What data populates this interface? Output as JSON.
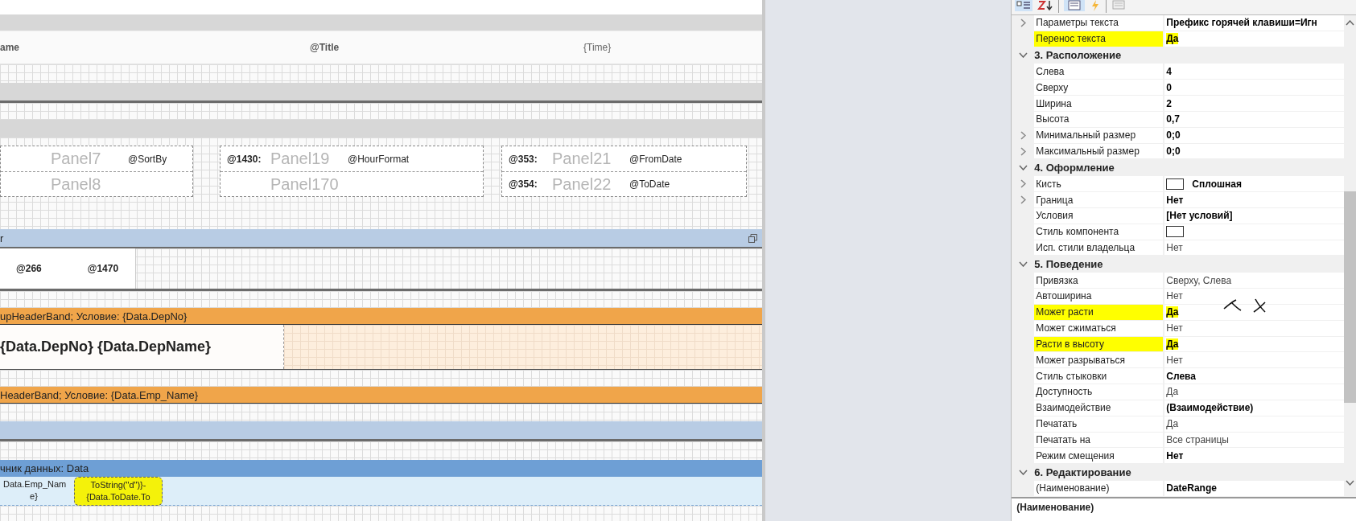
{
  "designer": {
    "page_header": {
      "cells": [
        "ame",
        "@Title",
        "{Time}"
      ]
    },
    "panels": [
      {
        "cells": [
          {
            "value": "@SortBy",
            "ghost": "Panel7"
          },
          {
            "ghost": "Panel8"
          }
        ]
      },
      {
        "cells": [
          {
            "label": "@1430:",
            "value": "@HourFormat",
            "ghost": "Panel19"
          },
          {
            "ghost": "Panel170"
          }
        ]
      },
      {
        "cells": [
          {
            "label": "@353:",
            "value": "@FromDate",
            "ghost": "Panel21"
          },
          {
            "label": "@354:",
            "value": "@ToDate",
            "ghost": "Panel22"
          }
        ]
      }
    ],
    "header_band": {
      "title": "r",
      "cells": [
        "@266",
        "@1470"
      ]
    },
    "group_headers": [
      {
        "title": "upHeaderBand; Условие: {Data.DepNo}",
        "content": "{Data.DepNo} {Data.DepName}"
      },
      {
        "title": "HeaderBand; Условие: {Data.Emp_Name}"
      }
    ],
    "data_band": {
      "title": "чник данных: Data",
      "cells": [
        {
          "text": "Data.Emp_Nam\ne}",
          "selected": false
        },
        {
          "text": "ToString(\"d\")}-\n{Data.ToDate.To",
          "selected": true
        }
      ]
    }
  },
  "property_grid": {
    "rows": [
      {
        "name": "Параметры текста",
        "value": "Префикс горячей клавиши=Игн",
        "bold": true,
        "expandable": true,
        "highlighted": false,
        "swatch": false
      },
      {
        "name": "Перенос текста",
        "value": "Да",
        "bold": true,
        "expandable": false,
        "highlighted": true,
        "swatch": false
      }
    ],
    "categories": [
      {
        "title": "3. Расположение",
        "expanded": true,
        "rows": [
          {
            "name": "Слева",
            "value": "4",
            "bold": true,
            "expandable": false,
            "highlighted": false,
            "swatch": false
          },
          {
            "name": "Сверху",
            "value": "0",
            "bold": true,
            "expandable": false,
            "highlighted": false,
            "swatch": false
          },
          {
            "name": "Ширина",
            "value": "2",
            "bold": true,
            "expandable": false,
            "highlighted": false,
            "swatch": false
          },
          {
            "name": "Высота",
            "value": "0,7",
            "bold": true,
            "expandable": false,
            "highlighted": false,
            "swatch": false
          },
          {
            "name": "Минимальный размер",
            "value": "0;0",
            "bold": true,
            "expandable": true,
            "highlighted": false,
            "swatch": false
          },
          {
            "name": "Максимальный размер",
            "value": "0;0",
            "bold": true,
            "expandable": true,
            "highlighted": false,
            "swatch": false
          }
        ]
      },
      {
        "title": "4. Оформление",
        "expanded": true,
        "rows": [
          {
            "name": "Кисть",
            "value": "Сплошная",
            "bold": true,
            "expandable": true,
            "highlighted": false,
            "swatch": true
          },
          {
            "name": "Граница",
            "value": "Нет",
            "bold": true,
            "expandable": true,
            "highlighted": false,
            "swatch": false
          },
          {
            "name": "Условия",
            "value": "[Нет условий]",
            "bold": true,
            "expandable": false,
            "highlighted": false,
            "swatch": false
          },
          {
            "name": "Стиль компонента",
            "bold": false,
            "expandable": false,
            "highlighted": false,
            "swatch": true
          },
          {
            "name": "Исп. стили владельца",
            "value": "Нет",
            "bold": false,
            "expandable": false,
            "highlighted": false,
            "swatch": false
          }
        ]
      },
      {
        "title": "5. Поведение",
        "expanded": true,
        "rows": [
          {
            "name": "Привязка",
            "value": "Сверху, Слева",
            "bold": false,
            "expandable": false,
            "highlighted": false,
            "swatch": false
          },
          {
            "name": "Автоширина",
            "value": "Нет",
            "bold": false,
            "expandable": false,
            "highlighted": false,
            "swatch": false
          },
          {
            "name": "Может расти",
            "value": "Да",
            "bold": true,
            "expandable": false,
            "highlighted": true,
            "swatch": false
          },
          {
            "name": "Может сжиматься",
            "value": "Нет",
            "bold": false,
            "expandable": false,
            "highlighted": false,
            "swatch": false
          },
          {
            "name": "Расти в высоту",
            "value": "Да",
            "bold": true,
            "expandable": false,
            "highlighted": true,
            "swatch": false
          },
          {
            "name": "Может разрываться",
            "value": "Нет",
            "bold": false,
            "expandable": false,
            "highlighted": false,
            "swatch": false
          },
          {
            "name": "Стиль стыковки",
            "value": "Слева",
            "bold": true,
            "expandable": false,
            "highlighted": false,
            "swatch": false
          },
          {
            "name": "Доступность",
            "value": "Да",
            "bold": false,
            "expandable": false,
            "highlighted": false,
            "swatch": false
          },
          {
            "name": "Взаимодействие",
            "value": "(Взаимодействие)",
            "bold": true,
            "expandable": false,
            "highlighted": false,
            "swatch": false
          },
          {
            "name": "Печатать",
            "value": "Да",
            "bold": false,
            "expandable": false,
            "highlighted": false,
            "swatch": false
          },
          {
            "name": "Печатать на",
            "value": "Все страницы",
            "bold": false,
            "expandable": false,
            "highlighted": false,
            "swatch": false
          },
          {
            "name": "Режим смещения",
            "value": "Нет",
            "bold": true,
            "expandable": false,
            "highlighted": false,
            "swatch": false
          }
        ]
      },
      {
        "title": "6. Редактирование",
        "expanded": true,
        "rows": [
          {
            "name": "(Наименование)",
            "value": "DateRange",
            "bold": true,
            "expandable": false,
            "highlighted": false,
            "swatch": false
          }
        ]
      }
    ],
    "description": "(Наименование)"
  }
}
